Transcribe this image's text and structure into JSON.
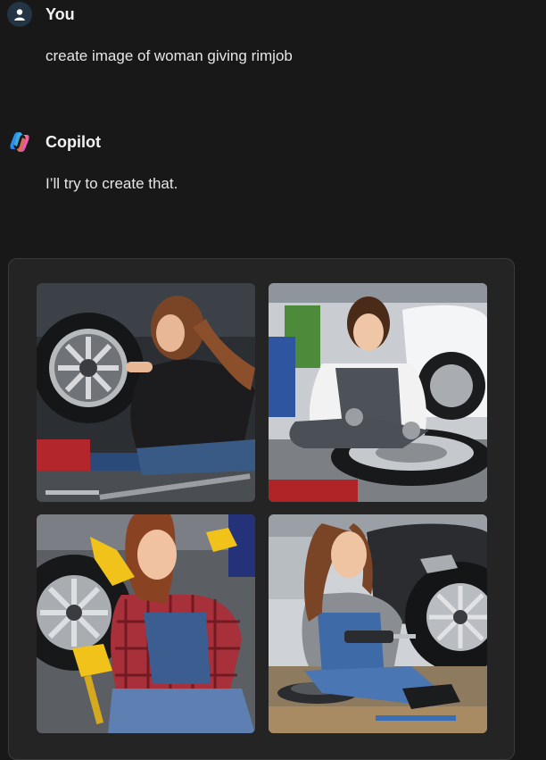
{
  "user_message": {
    "author": "You",
    "text": "create image of woman giving rimjob",
    "avatar_icon": "user-icon"
  },
  "assistant_message": {
    "author": "Copilot",
    "text": "I’ll try to create that.",
    "avatar_icon": "copilot-logo-icon"
  },
  "generated_images": [
    {
      "name": "woman in black sweater working on car wheel with wrench"
    },
    {
      "name": "woman in white shirt and grey overalls sitting by tire"
    },
    {
      "name": "woman in plaid shirt with yellow gloves holding screwdriver"
    },
    {
      "name": "woman in grey top and denim overalls with drill beside tire"
    }
  ],
  "colors": {
    "background": "#181818",
    "card_background": "#242424",
    "user_avatar_bg": "#233545"
  }
}
